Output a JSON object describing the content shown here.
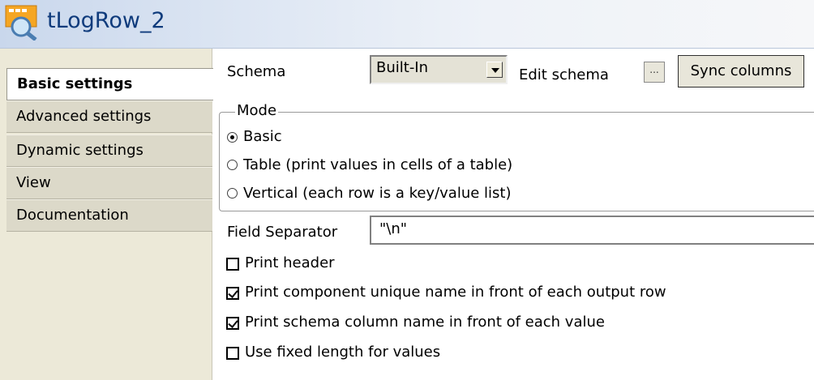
{
  "title": {
    "text": "tLogRow_2",
    "icon": "log-row-component-icon"
  },
  "tabs": [
    {
      "label": "Basic settings",
      "active": true
    },
    {
      "label": "Advanced settings",
      "active": false
    },
    {
      "label": "Dynamic settings",
      "active": false
    },
    {
      "label": "View",
      "active": false
    },
    {
      "label": "Documentation",
      "active": false
    }
  ],
  "schema": {
    "label": "Schema",
    "selected": "Built-In",
    "edit_label": "Edit schema",
    "dots_label": "...",
    "sync_label": "Sync columns"
  },
  "mode": {
    "legend": "Mode",
    "options": [
      {
        "label": "Basic",
        "checked": true
      },
      {
        "label": "Table (print values in cells of a table)",
        "checked": false
      },
      {
        "label": "Vertical (each row is a key/value list)",
        "checked": false
      }
    ]
  },
  "field_separator": {
    "label": "Field Separator",
    "value": "\"\\n\""
  },
  "checkboxes": [
    {
      "label": "Print header",
      "checked": false
    },
    {
      "label": "Print component unique name in front of each output row",
      "checked": true
    },
    {
      "label": "Print schema column name in front of each value",
      "checked": true
    },
    {
      "label": "Use fixed length for values",
      "checked": false
    }
  ],
  "colors": {
    "title_text": "#0f3b7c",
    "tab_bg": "#dcd9c9",
    "panel_bg": "#ece9d8"
  }
}
